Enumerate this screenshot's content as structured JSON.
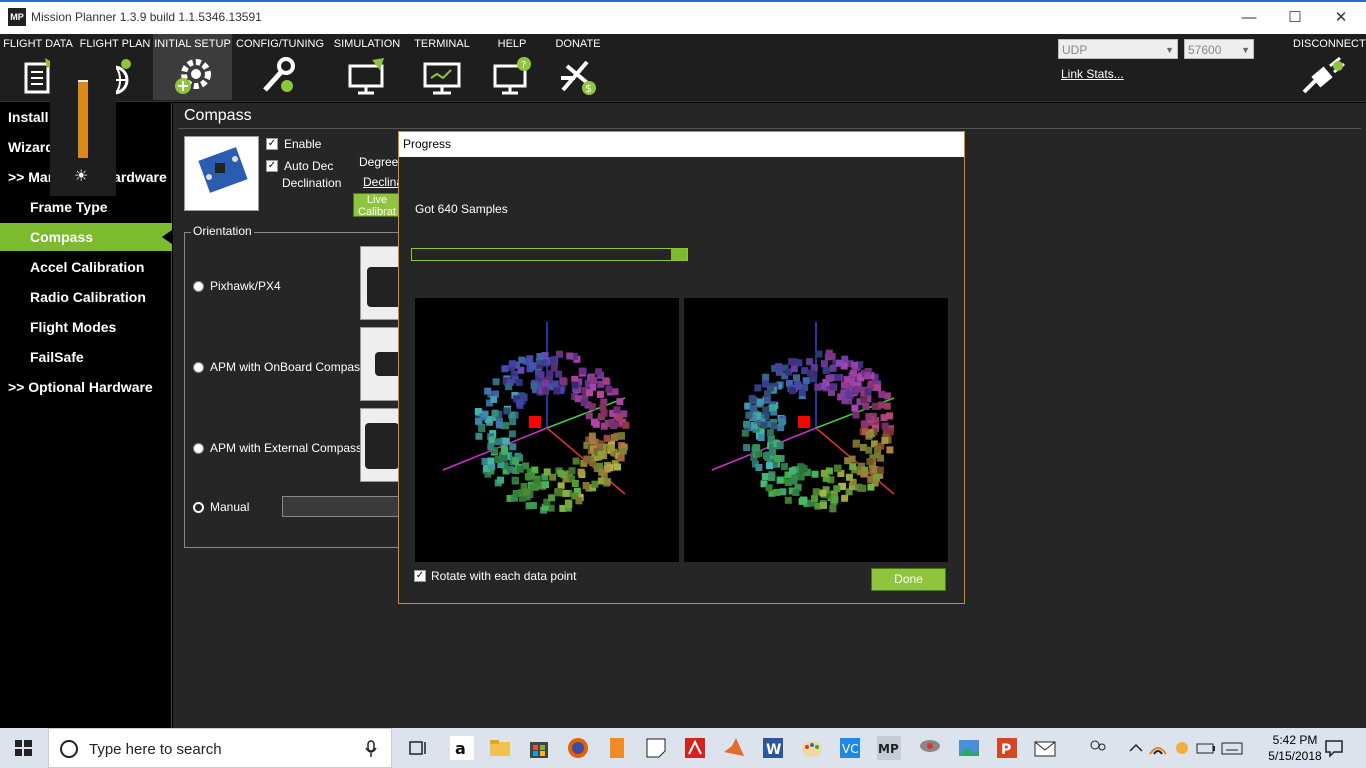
{
  "window": {
    "title": "Mission Planner 1.3.9 build 1.1.5346.13591",
    "icon_text": "MP",
    "minimize": "—",
    "maximize": "☐",
    "close": "✕"
  },
  "menu": {
    "items": [
      {
        "label": "FLIGHT DATA",
        "icon": "flight-data-icon"
      },
      {
        "label": "FLIGHT PLAN",
        "icon": "flight-plan-icon"
      },
      {
        "label": "INITIAL SETUP",
        "icon": "initial-setup-icon",
        "active": true
      },
      {
        "label": "CONFIG/TUNING",
        "icon": "config-tuning-icon"
      },
      {
        "label": "SIMULATION",
        "icon": "simulation-icon"
      },
      {
        "label": "TERMINAL",
        "icon": "terminal-icon"
      },
      {
        "label": "HELP",
        "icon": "help-icon"
      },
      {
        "label": "DONATE",
        "icon": "donate-icon"
      }
    ],
    "connection_type": "UDP",
    "baud_rate": "57600",
    "link_stats": "Link Stats...",
    "disconnect": "DISCONNECT"
  },
  "sidebar": {
    "items": [
      {
        "label": "Install Firmware"
      },
      {
        "label": "Wizard"
      },
      {
        "label": ">> Mandatory Hardware"
      },
      {
        "label": "Frame Type"
      },
      {
        "label": "Compass",
        "active": true
      },
      {
        "label": "Accel Calibration"
      },
      {
        "label": "Radio Calibration"
      },
      {
        "label": "Flight Modes"
      },
      {
        "label": "FailSafe"
      },
      {
        "label": ">> Optional Hardware"
      }
    ],
    "brightness_level": 0.97,
    "brightness_icon": "sun-icon"
  },
  "compass": {
    "title": "Compass",
    "enable_label": "Enable",
    "enable_checked": true,
    "auto_dec_label": "Auto Dec",
    "declination_label": "Declination",
    "auto_dec_checked": true,
    "degrees_label": "Degrees",
    "declination_link": "Declina",
    "live_calibration_label": "Live Calibrat",
    "orientation_legend": "Orientation",
    "options": [
      {
        "label": "Pixhawk/PX4",
        "selected": false
      },
      {
        "label": "APM with OnBoard Compass",
        "selected": false
      },
      {
        "label": "APM with External Compass",
        "selected": false
      },
      {
        "label": "Manual",
        "selected": true
      }
    ]
  },
  "progress_dialog": {
    "title": "Progress",
    "message": "Got 640 Samples",
    "progress": 0.06,
    "rotate_label": "Rotate with each data point",
    "rotate_checked": true,
    "done_label": "Done"
  },
  "taskbar": {
    "search_placeholder": "Type here to search",
    "time": "5:42 PM",
    "date": "5/15/2018"
  },
  "colors": {
    "accent_green": "#7bbb2d",
    "dialog_border": "#d98a1b"
  }
}
